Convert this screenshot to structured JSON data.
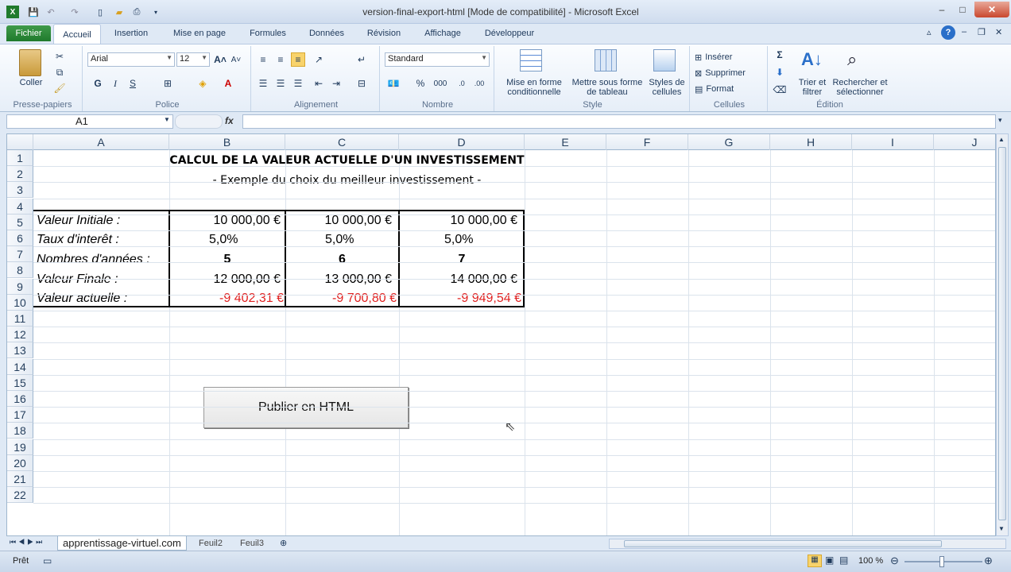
{
  "titlebar": {
    "title": "version-final-export-html  [Mode de compatibilité]  -  Microsoft Excel",
    "min": "–",
    "max": "□",
    "close": "✕"
  },
  "tabs": {
    "file": "Fichier",
    "items": [
      "Accueil",
      "Insertion",
      "Mise en page",
      "Formules",
      "Données",
      "Révision",
      "Affichage",
      "Développeur"
    ]
  },
  "ribbon": {
    "clipboard": {
      "paste": "Coller",
      "label": "Presse-papiers"
    },
    "font": {
      "name": "Arial",
      "size": "12",
      "bold": "G",
      "italic": "I",
      "underline": "S",
      "label": "Police"
    },
    "alignment": {
      "label": "Alignement"
    },
    "number": {
      "format": "Standard",
      "percent": "%",
      "thousands": "000",
      "label": "Nombre"
    },
    "style": {
      "cond": "Mise en forme",
      "cond2": "conditionnelle",
      "table": "Mettre sous forme",
      "table2": "de tableau",
      "cellstyles": "Styles de",
      "cellstyles2": "cellules",
      "label": "Style"
    },
    "cells": {
      "insert": "Insérer",
      "delete": "Supprimer",
      "format": "Format",
      "label": "Cellules"
    },
    "editing": {
      "sort": "Trier et",
      "sort2": "filtrer",
      "find": "Rechercher et",
      "find2": "sélectionner",
      "label": "Édition"
    }
  },
  "formula": {
    "namebox": "A1",
    "fx": "fx",
    "value": ""
  },
  "grid": {
    "columns": [
      "A",
      "B",
      "C",
      "D",
      "E",
      "F",
      "G",
      "H",
      "I",
      "J"
    ],
    "rows": [
      "1",
      "2",
      "3",
      "4",
      "5",
      "6",
      "7",
      "8",
      "9",
      "10",
      "11",
      "12",
      "13",
      "14",
      "15",
      "16",
      "17",
      "18",
      "19",
      "20",
      "21",
      "22"
    ],
    "title": "CALCUL DE LA VALEUR ACTUELLE D'UN INVESTISSEMENT",
    "subtitle": "- Exemple du choix du meilleur investissement -",
    "labels": [
      "Valeur Initiale :",
      "Taux d'interêt :",
      "Nombres d'années :",
      "Valeur Finale :",
      "Valeur actuelle :"
    ],
    "b": [
      "10 000,00 €",
      "5,0%",
      "5",
      "12 000,00 €",
      "-9 402,31 €"
    ],
    "c": [
      "10 000,00 €",
      "5,0%",
      "6",
      "13 000,00 €",
      "-9 700,80 €"
    ],
    "d": [
      "10 000,00 €",
      "5,0%",
      "7",
      "14 000,00 €",
      "-9 949,54 €"
    ]
  },
  "button": {
    "label": "Publier en HTML"
  },
  "sheets": {
    "tabs": [
      "apprentissage-virtuel.com",
      "Feuil2",
      "Feuil3"
    ]
  },
  "status": {
    "ready": "Prêt",
    "zoom": "100 %"
  },
  "colors": {
    "negative": "#e0201f",
    "file_tab": "#1f7a2c",
    "close": "#c9472e"
  }
}
